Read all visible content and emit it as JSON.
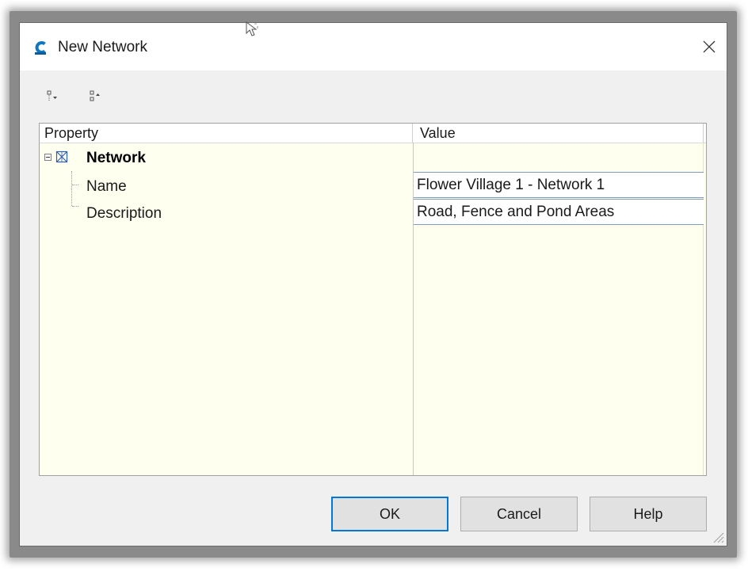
{
  "window": {
    "title": "New Network",
    "app_icon": "civil3d-c-icon",
    "close_icon": "close-icon"
  },
  "toolbar": {
    "buttons": [
      {
        "icon": "expand-all-icon",
        "label": ""
      },
      {
        "icon": "collapse-all-icon",
        "label": ""
      }
    ]
  },
  "grid": {
    "columns": [
      "Property",
      "Value"
    ],
    "group": {
      "label": "Network",
      "icon": "network-icon",
      "expanded": true
    },
    "rows": [
      {
        "property": "Name",
        "value": "Flower Village 1 - Network 1"
      },
      {
        "property": "Description",
        "value": "Road, Fence and Pond Areas"
      }
    ]
  },
  "buttons": {
    "ok": "OK",
    "cancel": "Cancel",
    "help": "Help"
  },
  "colors": {
    "grid_background": "#fffff0",
    "accent": "#0078d7",
    "column_divider": "#f2b8b8"
  }
}
